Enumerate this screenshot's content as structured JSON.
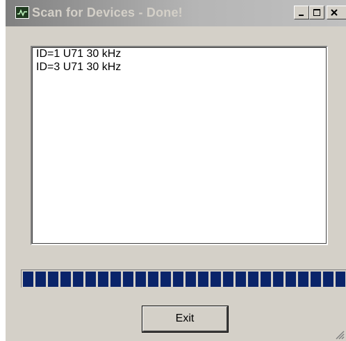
{
  "window": {
    "title": "Scan for Devices - Done!",
    "app_icon": "oscilloscope-icon",
    "controls": [
      "minimize-icon",
      "maximize-icon",
      "close-icon"
    ]
  },
  "device_list": {
    "items": [
      "ID=1 U71 30 kHz",
      "ID=3 U71 30 kHz"
    ]
  },
  "progress": {
    "value": 1.0,
    "color": "#0a246a"
  },
  "buttons": {
    "exit_label": "Exit"
  }
}
